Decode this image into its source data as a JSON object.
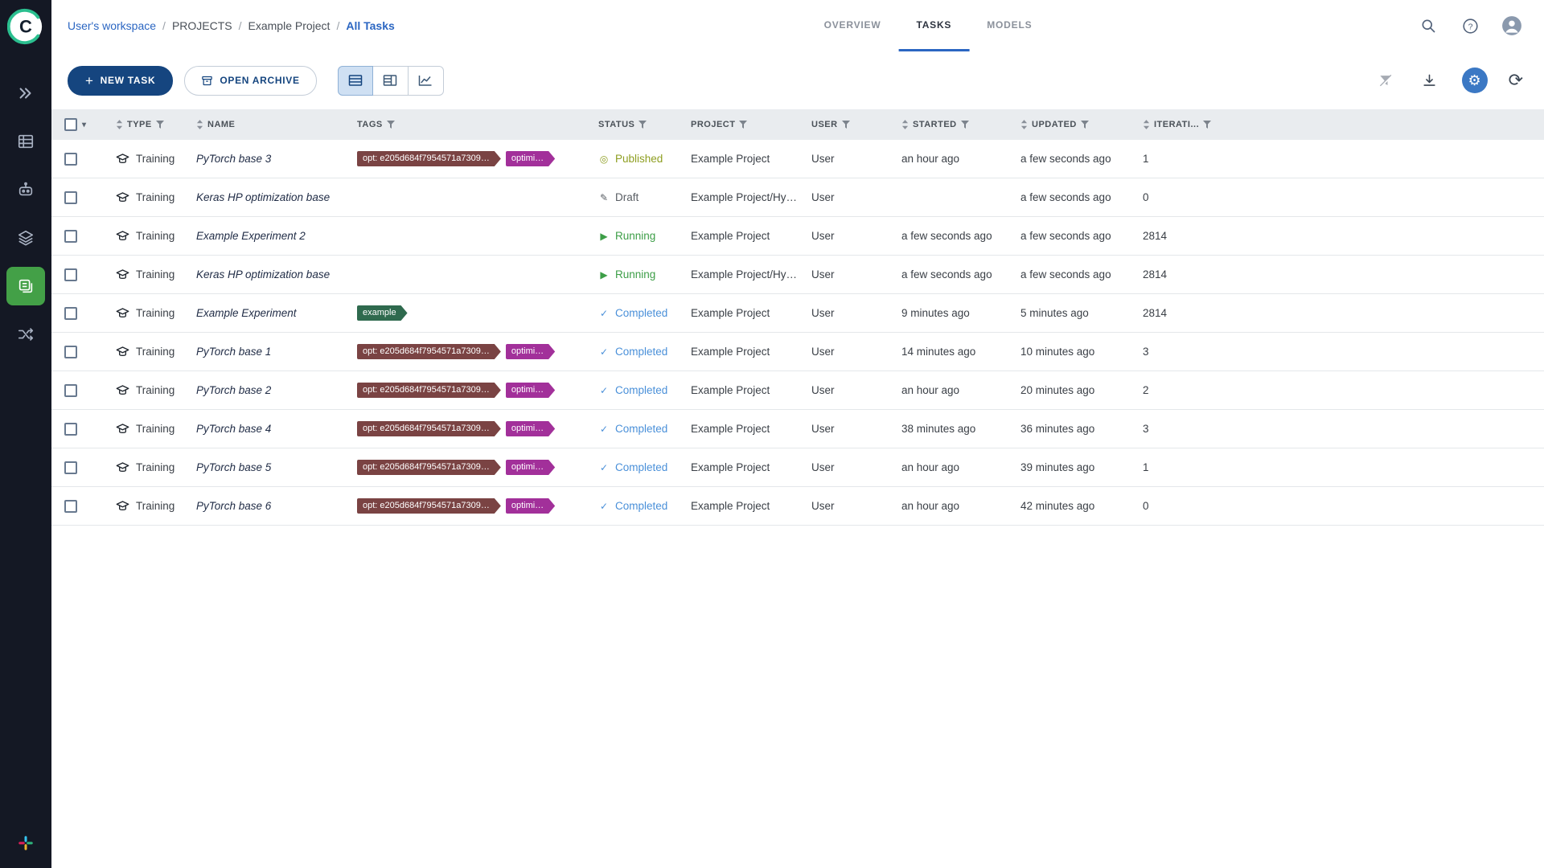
{
  "sidebar": {
    "items": [
      {
        "id": "expand",
        "active": false
      },
      {
        "id": "projects",
        "active": false
      },
      {
        "id": "workers",
        "active": false
      },
      {
        "id": "datasets",
        "active": false
      },
      {
        "id": "experiments",
        "active": true
      },
      {
        "id": "pipelines",
        "active": false
      }
    ]
  },
  "breadcrumb": {
    "items": [
      {
        "label": "User's workspace",
        "link": true
      },
      {
        "label": "PROJECTS",
        "link": false
      },
      {
        "label": "Example Project",
        "link": false
      },
      {
        "label": "All Tasks",
        "link": true
      }
    ],
    "separator": "/"
  },
  "tabs": {
    "items": [
      {
        "label": "OVERVIEW",
        "active": false
      },
      {
        "label": "TASKS",
        "active": true
      },
      {
        "label": "MODELS",
        "active": false
      }
    ]
  },
  "toolbar": {
    "new_task_label": "NEW TASK",
    "open_archive_label": "OPEN ARCHIVE"
  },
  "table": {
    "select_caret": "▾",
    "columns": [
      {
        "label": "TYPE"
      },
      {
        "label": "NAME"
      },
      {
        "label": "TAGS"
      },
      {
        "label": "STATUS"
      },
      {
        "label": "PROJECT"
      },
      {
        "label": "USER"
      },
      {
        "label": "STARTED"
      },
      {
        "label": "UPDATED"
      },
      {
        "label": "ITERATI..."
      }
    ],
    "rows": [
      {
        "type": "Training",
        "name": "PyTorch base 3",
        "tags": [
          {
            "label": "opt: e205d684f7954571a7309…",
            "color": "#7a4343"
          },
          {
            "label": "optimi…",
            "color": "#a2309a"
          }
        ],
        "status": "Published",
        "project": "Example Project",
        "user": "User",
        "started": "an hour ago",
        "updated": "a few seconds ago",
        "iterations": "1"
      },
      {
        "type": "Training",
        "name": "Keras HP optimization base",
        "tags": [],
        "status": "Draft",
        "project": "Example Project/Hy…",
        "user": "User",
        "started": "",
        "updated": "a few seconds ago",
        "iterations": "0"
      },
      {
        "type": "Training",
        "name": "Example Experiment 2",
        "tags": [],
        "status": "Running",
        "project": "Example Project",
        "user": "User",
        "started": "a few seconds ago",
        "updated": "a few seconds ago",
        "iterations": "2814"
      },
      {
        "type": "Training",
        "name": "Keras HP optimization base",
        "tags": [],
        "status": "Running",
        "project": "Example Project/Hy…",
        "user": "User",
        "started": "a few seconds ago",
        "updated": "a few seconds ago",
        "iterations": "2814"
      },
      {
        "type": "Training",
        "name": "Example Experiment",
        "tags": [
          {
            "label": "example",
            "color": "#2f6a4e"
          }
        ],
        "status": "Completed",
        "project": "Example Project",
        "user": "User",
        "started": "9 minutes ago",
        "updated": "5 minutes ago",
        "iterations": "2814"
      },
      {
        "type": "Training",
        "name": "PyTorch base 1",
        "tags": [
          {
            "label": "opt: e205d684f7954571a7309…",
            "color": "#7a4343"
          },
          {
            "label": "optimi…",
            "color": "#a2309a"
          }
        ],
        "status": "Completed",
        "project": "Example Project",
        "user": "User",
        "started": "14 minutes ago",
        "updated": "10 minutes ago",
        "iterations": "3"
      },
      {
        "type": "Training",
        "name": "PyTorch base 2",
        "tags": [
          {
            "label": "opt: e205d684f7954571a7309…",
            "color": "#7a4343"
          },
          {
            "label": "optimi…",
            "color": "#a2309a"
          }
        ],
        "status": "Completed",
        "project": "Example Project",
        "user": "User",
        "started": "an hour ago",
        "updated": "20 minutes ago",
        "iterations": "2"
      },
      {
        "type": "Training",
        "name": "PyTorch base 4",
        "tags": [
          {
            "label": "opt: e205d684f7954571a7309…",
            "color": "#7a4343"
          },
          {
            "label": "optimi…",
            "color": "#a2309a"
          }
        ],
        "status": "Completed",
        "project": "Example Project",
        "user": "User",
        "started": "38 minutes ago",
        "updated": "36 minutes ago",
        "iterations": "3"
      },
      {
        "type": "Training",
        "name": "PyTorch base 5",
        "tags": [
          {
            "label": "opt: e205d684f7954571a7309…",
            "color": "#7a4343"
          },
          {
            "label": "optimi…",
            "color": "#a2309a"
          }
        ],
        "status": "Completed",
        "project": "Example Project",
        "user": "User",
        "started": "an hour ago",
        "updated": "39 minutes ago",
        "iterations": "1"
      },
      {
        "type": "Training",
        "name": "PyTorch base 6",
        "tags": [
          {
            "label": "opt: e205d684f7954571a7309…",
            "color": "#7a4343"
          },
          {
            "label": "optimi…",
            "color": "#a2309a"
          }
        ],
        "status": "Completed",
        "project": "Example Project",
        "user": "User",
        "started": "an hour ago",
        "updated": "42 minutes ago",
        "iterations": "0"
      }
    ]
  },
  "status_icons": {
    "Published": "◎",
    "Draft": "✎",
    "Running": "▶",
    "Completed": "✓"
  },
  "status_colors": {
    "Published": "#8e9e21",
    "Draft": "#585d63",
    "Running": "#3d9e47",
    "Completed": "#4a90d9"
  }
}
